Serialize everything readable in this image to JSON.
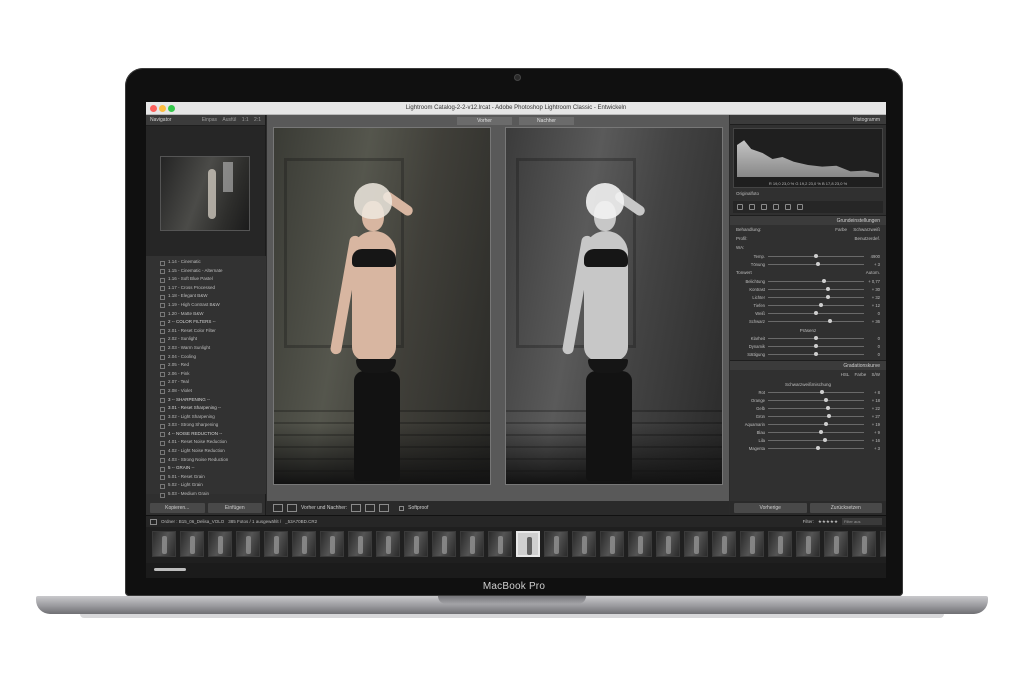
{
  "window": {
    "title": "Lightroom Catalog-2-2-v12.lrcat - Adobe Photoshop Lightroom Classic - Entwickeln"
  },
  "device": {
    "label": "MacBook Pro"
  },
  "left_panel": {
    "navigator_title": "Navigator",
    "zoom_options": [
      "Einpas",
      "Ausfül",
      "1:1",
      "2:1"
    ],
    "presets": [
      "1.14 - Cinematic",
      "1.15 - Cinematic - Alternate",
      "1.16 - Soft Blue Pastel",
      "1.17 - Cross Processed",
      "1.18 - Elegant B&W",
      "1.19 - High Contrast B&W",
      "1.20 - Matte B&W",
      "2 -- COLOR FILTERS --",
      "2.01 - Reset Color Filter",
      "2.02 - Sunlight",
      "2.03 - Warm Sunlight",
      "2.04 - Cooling",
      "2.05 - Red",
      "2.06 - Pink",
      "2.07 - Teal",
      "2.08 - Violet",
      "3 -- SHARPENING --",
      "3.01 - Reset Sharpening --",
      "3.02 - Light Sharpening",
      "3.03 - Strong Sharpening",
      "4 -- NOISE REDUCTION --",
      "4.01 - Reset Noise Reduction",
      "4.02 - Light Noise Reduction",
      "4.03 - Strong Noise Reduction",
      "5 -- GRAIN --",
      "5.01 - Reset Grain",
      "5.02 - Light Grain",
      "5.03 - Medium Grain"
    ],
    "buttons": [
      "Kopieren...",
      "Einfügen"
    ]
  },
  "center": {
    "before_label": "Vorher",
    "after_label": "Nachher",
    "toolbar": {
      "view_mode_label": "Vorher und Nachher:",
      "softproof_label": "Softproof"
    }
  },
  "right_panel": {
    "histogram_title": "Histogramm",
    "histogram_values": "R 19,0 23,0 % G 19,2 23,0 % B 17,8 23,0 %",
    "original_photo_label": "Originalfoto",
    "basic_title": "Grundeinstellungen",
    "treatment_label": "Behandlung:",
    "treatment_options": [
      "Farbe",
      "Schwarzweiß"
    ],
    "profile_label": "Profil:",
    "profile_value": "Benutzerdef.",
    "wb_label": "WA:",
    "tone_label": "Tonwert",
    "tone_auto": "Autom.",
    "presence_label": "Präsenz",
    "sliders_wb": [
      {
        "label": "Temp.",
        "value": "4900",
        "pos": 0.5
      },
      {
        "label": "Tönung",
        "value": "+ 3",
        "pos": 0.52
      }
    ],
    "sliders_tone": [
      {
        "label": "Belichtung",
        "value": "+ 0,77",
        "pos": 0.58
      },
      {
        "label": "Kontrast",
        "value": "+ 30",
        "pos": 0.62
      },
      {
        "label": "Lichter",
        "value": "+ 32",
        "pos": 0.63
      },
      {
        "label": "Tiefen",
        "value": "+ 12",
        "pos": 0.55
      },
      {
        "label": "Weiß",
        "value": "0",
        "pos": 0.5
      },
      {
        "label": "Schwarz",
        "value": "+ 36",
        "pos": 0.65
      }
    ],
    "sliders_presence": [
      {
        "label": "Klarheit",
        "value": "0",
        "pos": 0.5
      },
      {
        "label": "Dynamik",
        "value": "0",
        "pos": 0.5
      },
      {
        "label": "Sättigung",
        "value": "0",
        "pos": 0.5
      }
    ],
    "curve_title": "Gradationskurve",
    "hsl_tabs": [
      "HSL",
      "Farbe",
      "S/W"
    ],
    "bw_mix_label": "Schwarzweißmischung",
    "sliders_bw": [
      {
        "label": "Rot",
        "value": "+ 8",
        "pos": 0.56
      },
      {
        "label": "Orange",
        "value": "+ 18",
        "pos": 0.6
      },
      {
        "label": "Gelb",
        "value": "+ 22",
        "pos": 0.62
      },
      {
        "label": "Grün",
        "value": "+ 27",
        "pos": 0.64
      },
      {
        "label": "Aquamarin",
        "value": "+ 19",
        "pos": 0.6
      },
      {
        "label": "Blau",
        "value": "+ 9",
        "pos": 0.55
      },
      {
        "label": "Lila",
        "value": "+ 16",
        "pos": 0.59
      },
      {
        "label": "Magenta",
        "value": "+ 3",
        "pos": 0.52
      }
    ],
    "buttons": [
      "Vorherige",
      "Zurücksetzen"
    ]
  },
  "filmstrip_bar": {
    "source": "Ordner : B15_06_Delisa_VOLO",
    "count": "385 Fotos / 1 ausgewählt /",
    "filename": "_53A70BD.CR2",
    "filter_label": "Filter:",
    "search_placeholder": "Filter aus"
  },
  "filmstrip": {
    "thumb_count": 27,
    "selected_index": 13
  }
}
